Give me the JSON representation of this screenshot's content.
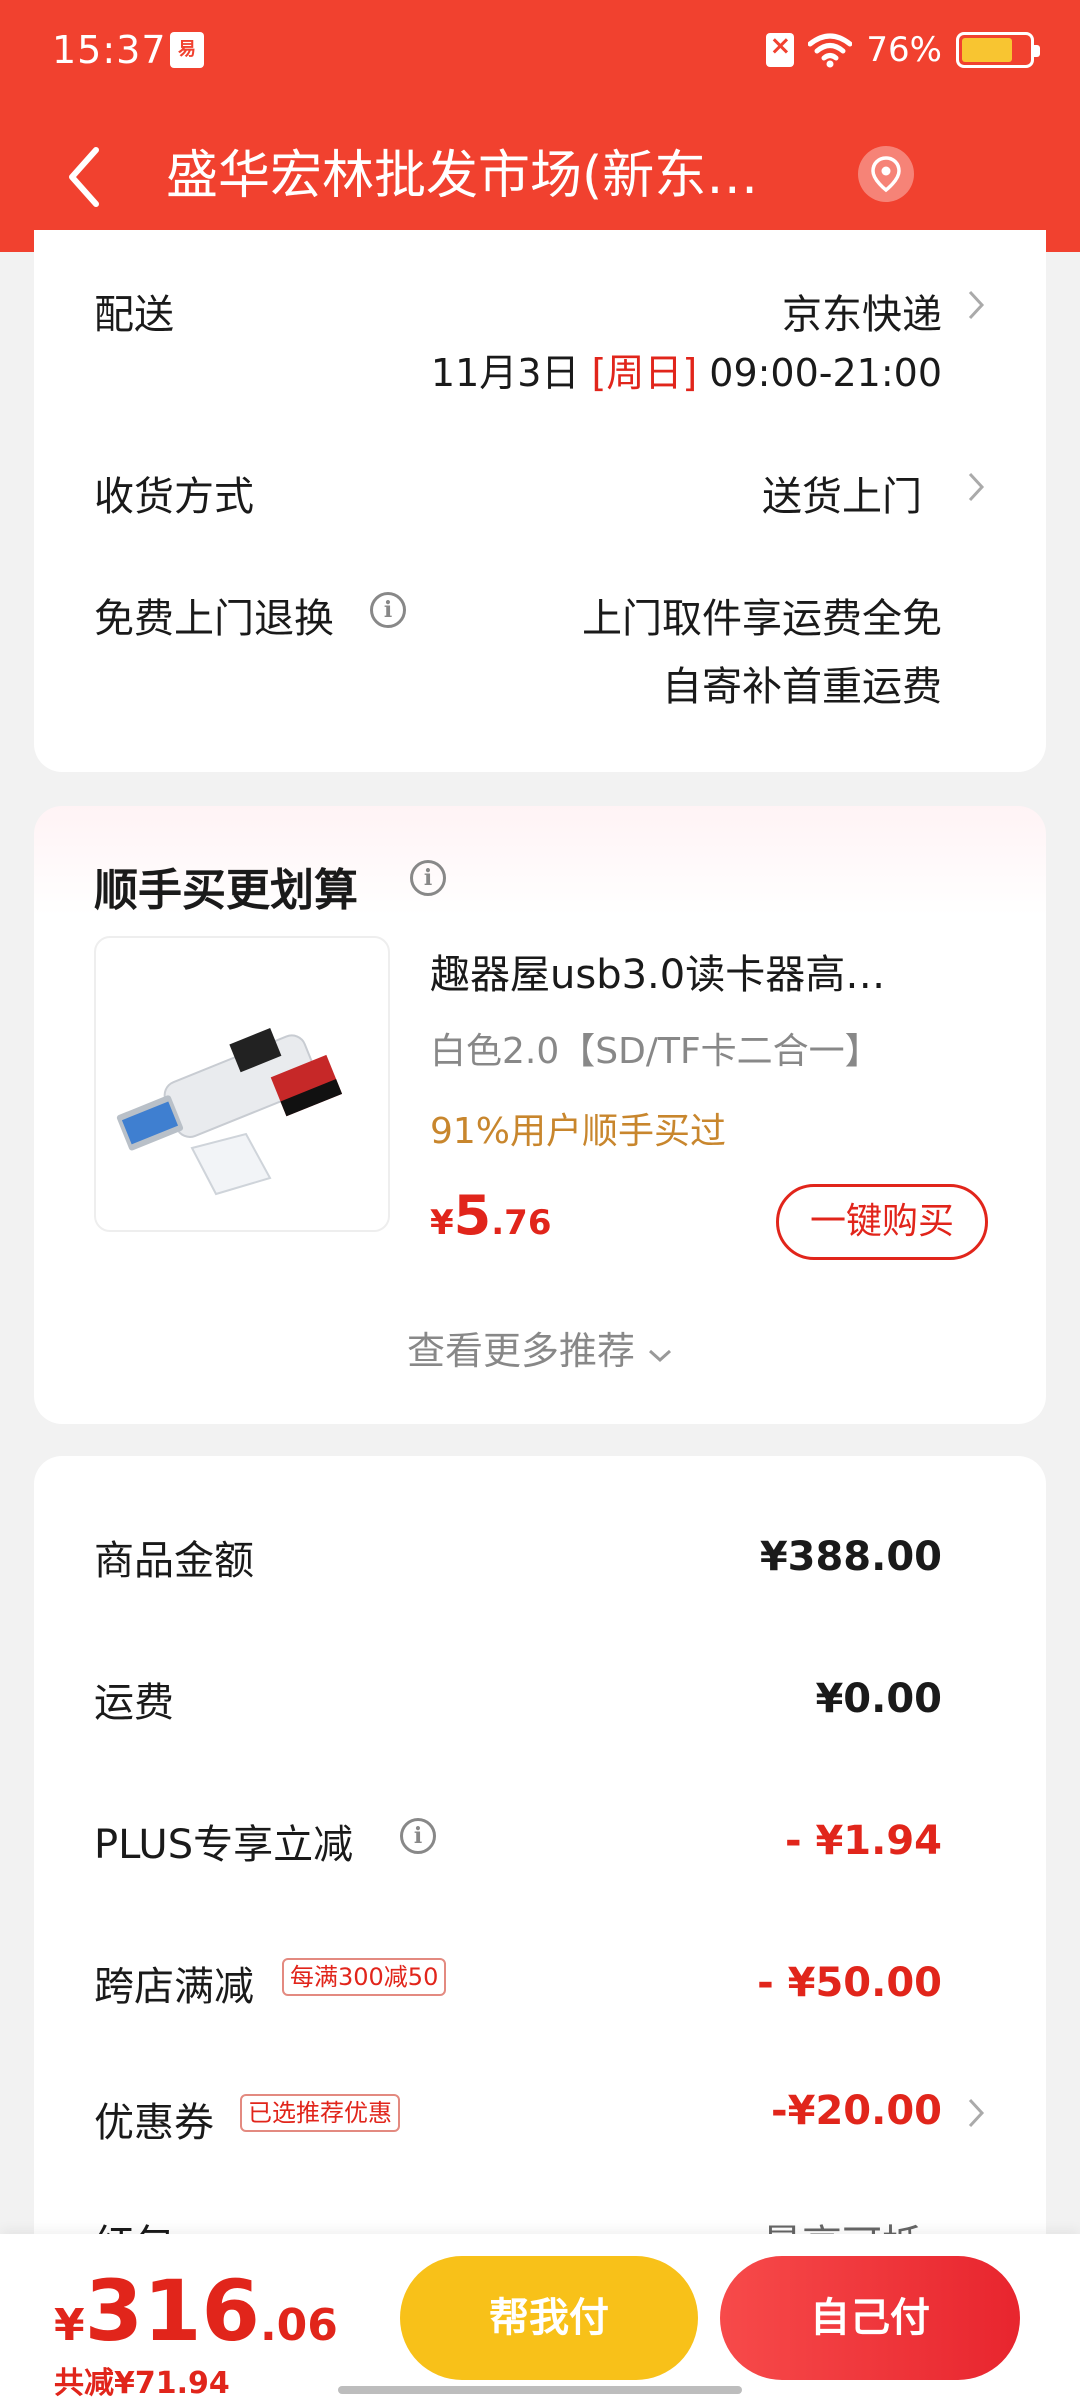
{
  "status_bar": {
    "time": "15:37",
    "battery": "76%",
    "battery_level": 0.76
  },
  "nav": {
    "title": "盛华宏林批发市场(新东…"
  },
  "delivery": {
    "label": "配送",
    "carrier": "京东快递",
    "date": "11月3日",
    "weekday": "[周日]",
    "time_window": "09:00-21:00"
  },
  "receive": {
    "label": "收货方式",
    "value": "送货上门"
  },
  "return_service": {
    "label": "免费上门退换",
    "line1": "上门取件享运费全免",
    "line2": "自寄补首重运费"
  },
  "recommend": {
    "title": "顺手买更划算",
    "product": {
      "name": "趣器屋usb3.0读卡器高…",
      "spec": "白色2.0【SD/TF卡二合一】",
      "tip": "91%用户顺手买过",
      "price_symbol": "¥",
      "price_int": "5",
      "price_dec": ".76",
      "buy_label": "一键购买"
    },
    "more": "查看更多推荐"
  },
  "summary": {
    "goods": {
      "label": "商品金额",
      "value": "¥388.00"
    },
    "shipping": {
      "label": "运费",
      "value": "¥0.00"
    },
    "plus": {
      "label": "PLUS专享立减",
      "value": "- ¥1.94"
    },
    "cross_store": {
      "label": "跨店满减",
      "tag": "每满300减50",
      "value": "- ¥50.00"
    },
    "coupon": {
      "label": "优惠券",
      "tag": "已选推荐优惠",
      "value": "-¥20.00"
    },
    "red_packet": {
      "label": "红包",
      "value": "最高可抵"
    }
  },
  "bottom": {
    "price_symbol": "¥",
    "price_int": "316",
    "price_dec": ".06",
    "saving": "共减¥71.94",
    "help_pay": "帮我付",
    "self_pay": "自己付"
  },
  "colors": {
    "header_red": "#f1412f",
    "price_red": "#e1251b",
    "help_yellow": "#f8c119"
  }
}
